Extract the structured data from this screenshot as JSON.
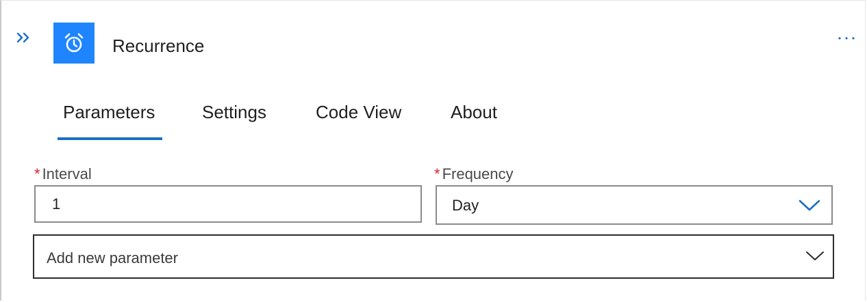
{
  "action": {
    "title": "Recurrence",
    "icon": "alarm-clock-icon",
    "accent_color": "#1f85ff"
  },
  "tabs": [
    {
      "label": "Parameters",
      "selected": true
    },
    {
      "label": "Settings",
      "selected": false
    },
    {
      "label": "Code View",
      "selected": false
    },
    {
      "label": "About",
      "selected": false
    }
  ],
  "fields": {
    "interval": {
      "label": "Interval",
      "required_mark": "*",
      "value": "1"
    },
    "frequency": {
      "label": "Frequency",
      "required_mark": "*",
      "value": "Day"
    }
  },
  "add_parameter": {
    "placeholder": "Add new parameter"
  },
  "colors": {
    "tab_underline": "#1a6fc4",
    "required": "#e0202e",
    "chevron_blue": "#1a6fc4"
  }
}
